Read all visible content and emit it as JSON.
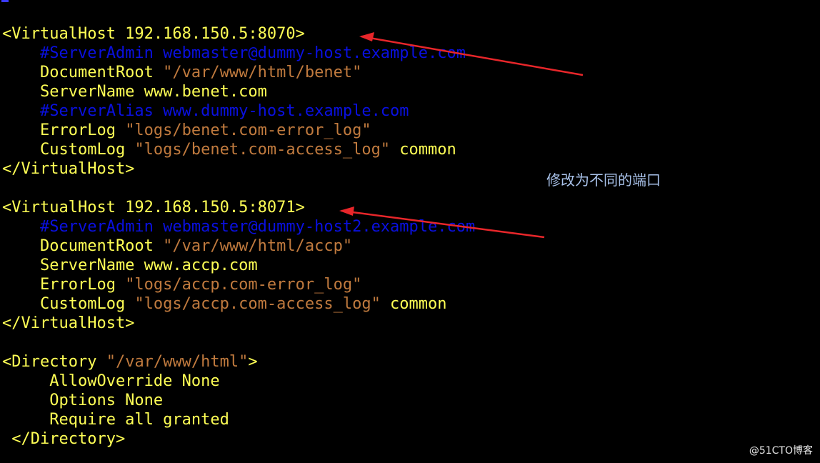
{
  "terminal": {
    "lines": [
      [
        {
          "t": "<VirtualHost 192.168.150.5:8070>",
          "c": "y"
        }
      ],
      [
        {
          "t": "    ",
          "c": "y"
        },
        {
          "t": "#ServerAdmin webmaster@dummy-host.example.com",
          "c": "b"
        }
      ],
      [
        {
          "t": "    DocumentRoot ",
          "c": "y"
        },
        {
          "t": "\"/var/www/html/benet\"",
          "c": "s"
        }
      ],
      [
        {
          "t": "    ServerName www.benet.com",
          "c": "y"
        }
      ],
      [
        {
          "t": "    ",
          "c": "y"
        },
        {
          "t": "#ServerAlias www.dummy-host.example.com",
          "c": "b"
        }
      ],
      [
        {
          "t": "    ErrorLog ",
          "c": "y"
        },
        {
          "t": "\"logs/benet.com-error_log\"",
          "c": "s"
        }
      ],
      [
        {
          "t": "    CustomLog ",
          "c": "y"
        },
        {
          "t": "\"logs/benet.com-access_log\"",
          "c": "s"
        },
        {
          "t": " common",
          "c": "y"
        }
      ],
      [
        {
          "t": "</VirtualHost>",
          "c": "y"
        }
      ],
      [],
      [
        {
          "t": "<VirtualHost 192.168.150.5:8071>",
          "c": "y"
        }
      ],
      [
        {
          "t": "    ",
          "c": "y"
        },
        {
          "t": "#ServerAdmin webmaster@dummy-host2.example.com",
          "c": "b"
        }
      ],
      [
        {
          "t": "    DocumentRoot ",
          "c": "y"
        },
        {
          "t": "\"/var/www/html/accp\"",
          "c": "s"
        }
      ],
      [
        {
          "t": "    ServerName www.accp.com",
          "c": "y"
        }
      ],
      [
        {
          "t": "    ErrorLog ",
          "c": "y"
        },
        {
          "t": "\"logs/accp.com-error_log\"",
          "c": "s"
        }
      ],
      [
        {
          "t": "    CustomLog ",
          "c": "y"
        },
        {
          "t": "\"logs/accp.com-access_log\"",
          "c": "s"
        },
        {
          "t": " common",
          "c": "y"
        }
      ],
      [
        {
          "t": "</VirtualHost>",
          "c": "y"
        }
      ],
      [],
      [
        {
          "t": "<Directory ",
          "c": "y"
        },
        {
          "t": "\"/var/www/html\"",
          "c": "s"
        },
        {
          "t": ">",
          "c": "y"
        }
      ],
      [
        {
          "t": "     AllowOverride None",
          "c": "y"
        }
      ],
      [
        {
          "t": "     Options None",
          "c": "y"
        }
      ],
      [
        {
          "t": "     Require all granted",
          "c": "y"
        }
      ],
      [
        {
          "t": " </Directory>",
          "c": "y"
        }
      ]
    ]
  },
  "annotation": "修改为不同的端口",
  "watermark": "@51CTO博客",
  "colors": {
    "background": "#000000",
    "keyword": "#ffff55",
    "comment": "#0a10e0",
    "string": "#c07a3e",
    "arrow": "#e8262a",
    "annotation": "#a9c2ea"
  }
}
